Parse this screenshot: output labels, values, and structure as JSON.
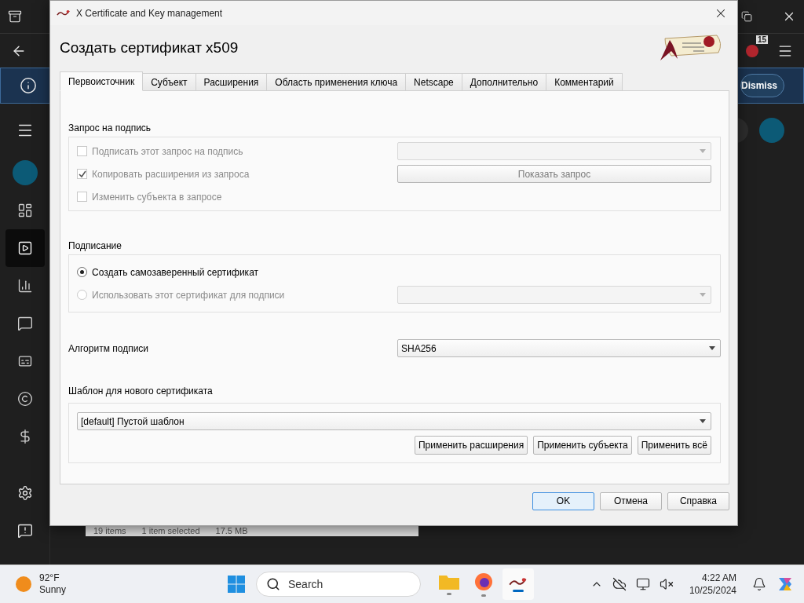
{
  "background_app": {
    "badge": "15",
    "banner": {
      "button": "Dismiss"
    },
    "sidebar": [
      {
        "kind": "dashboard",
        "selected": false
      },
      {
        "kind": "videos",
        "selected": true
      },
      {
        "kind": "analytics",
        "selected": false
      },
      {
        "kind": "comments",
        "selected": false
      },
      {
        "kind": "subtitles",
        "selected": false
      },
      {
        "kind": "copyright",
        "selected": false
      },
      {
        "kind": "earn",
        "selected": false
      }
    ],
    "status_bar": [
      "19 items",
      "1 item selected",
      "17.5 MB"
    ]
  },
  "dialog": {
    "title": "X Certificate and Key management",
    "heading": "Создать сертификат x509",
    "tabs": [
      {
        "label": "Первоисточник",
        "selected": true
      },
      {
        "label": "Субъект",
        "selected": false
      },
      {
        "label": "Расширения",
        "selected": false
      },
      {
        "label": "Область применения ключа",
        "selected": false
      },
      {
        "label": "Netscape",
        "selected": false
      },
      {
        "label": "Дополнительно",
        "selected": false
      },
      {
        "label": "Комментарий",
        "selected": false
      }
    ],
    "signing_request": {
      "title": "Запрос на подпись",
      "options": [
        {
          "label": "Подписать этот запрос на подпись",
          "checked": false,
          "disabled": true
        },
        {
          "label": "Копировать расширения из запроса",
          "checked": true,
          "disabled": true
        },
        {
          "label": "Изменить субъекта в запросе",
          "checked": false,
          "disabled": true
        }
      ],
      "request_select": {
        "disabled": true
      },
      "show_request_button": {
        "label": "Показать запрос",
        "disabled": true
      }
    },
    "signing": {
      "title": "Подписание",
      "options": [
        {
          "label": "Создать самозаверенный сертификат",
          "selected": true,
          "disabled": false
        },
        {
          "label": "Использовать этот сертификат для подписи",
          "selected": false,
          "disabled": true
        }
      ],
      "ca_select": {
        "disabled": true
      }
    },
    "algorithm": {
      "label": "Алгоритм подписи",
      "value": "SHA256"
    },
    "template": {
      "label": "Шаблон для нового сертификата",
      "value": "[default] Пустой шаблон",
      "buttons": [
        "Применить расширения",
        "Применить субъекта",
        "Применить всё"
      ]
    },
    "buttons": [
      {
        "label": "OK",
        "default": true
      },
      {
        "label": "Отмена",
        "default": false
      },
      {
        "label": "Справка",
        "default": false
      }
    ]
  },
  "taskbar": {
    "weather": {
      "temperature": "92°F",
      "condition": "Sunny"
    },
    "search": {
      "placeholder": "Search"
    },
    "apps": [
      {
        "kind": "folder",
        "selected": false
      },
      {
        "kind": "browser",
        "selected": false
      },
      {
        "kind": "certificates",
        "selected": true
      }
    ],
    "clock": {
      "time": "4:22 AM",
      "date": "10/25/2024"
    }
  }
}
